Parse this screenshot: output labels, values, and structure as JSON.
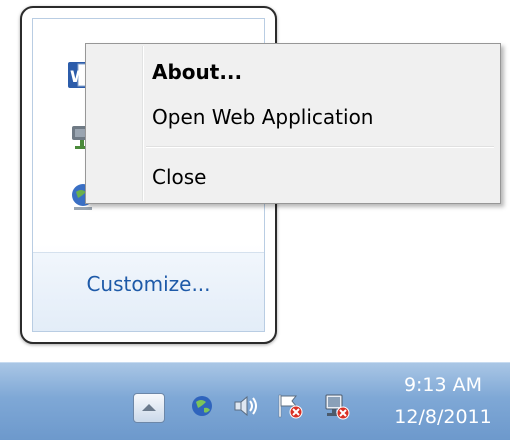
{
  "flyout": {
    "customize_label": "Customize...",
    "icons": [
      "word-icon",
      "network-device-icon",
      "globe-icon"
    ]
  },
  "context_menu": {
    "items": [
      {
        "label": "About...",
        "bold": true
      },
      {
        "label": "Open Web Application",
        "bold": false
      },
      {
        "label": "Close",
        "bold": false
      }
    ]
  },
  "taskbar": {
    "tray_icons": [
      "show-hidden-icons-button",
      "globe-icon",
      "volume-icon",
      "action-center-flag-icon",
      "network-icon"
    ],
    "clock": {
      "time": "9:13 AM",
      "date": "12/8/2011"
    }
  },
  "colors": {
    "link": "#1e5aa8",
    "taskbar": "#7fa8d6",
    "menu_background": "#f0f0f0"
  }
}
